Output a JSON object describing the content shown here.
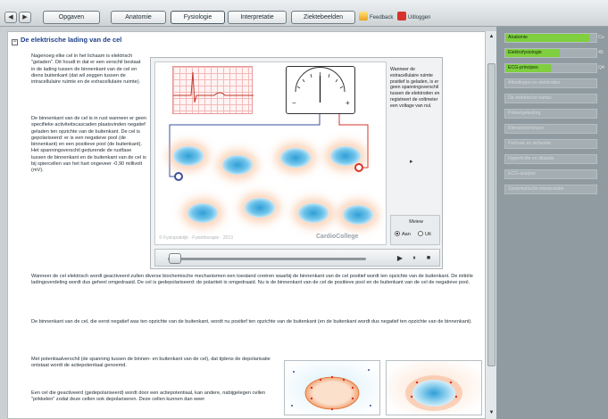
{
  "toolbar": {
    "back": "◀",
    "forward": "▶",
    "tabs": [
      "Opgaven",
      "Anatomie",
      "Fysiologie",
      "Interpretatie",
      "Ziektebeelden"
    ],
    "feedback": "Feedback",
    "exit": "Uitloggen"
  },
  "main": {
    "title": "De elektrische lading van de cel",
    "collapse": "−",
    "intro": "Nagenoeg elke cel in het lichaam is elektrisch \"geladen\". Dit houdt in dat er een verschil bestaat in de lading tussen de binnenkant van de cel en diens buitenkant (dat wil zeggen tussen de intracellulaire ruimte en de extracellulaire ruimte).",
    "rest": "De binnenkant van de cel is in rust wanneer er geen specifieke activiteitscascaden plaatsvinden negatief geladen ten opzichte van de buitenkant. De cel is gepolariseerd: er is een negatieve pool (de binnenkant) en een positieve pool (de buitenkant). Het spanningsverschil gedurende de rustfase tussen de binnenkant en de buitenkant van de cel is bij spiercellen van het hart ongeveer -0,90 millivolt (mV).",
    "depol1": "Wanneer de cel elektrisch wordt geactiveerd zullen diverse biochemische mechanismen een toestand creëren waarbij de binnenkant van de cel positief wordt ten opzichte van de buitenkant. De initiële ladingsverdeling wordt dus geheel omgedraaid. De cel is gedepolariseerd: de polariteit is omgedraaid. Nu is de binnenkant van de cel de positieve pool en de buitenkant van de cel de negatieve pool.",
    "depol2": "De binnenkant van de cel, die eerst negatief was ten opzichte van de buitenkant, wordt nu positief ten opzichte van de buitenkant (en de buitenkant wordt dus negatief ten opzichte van de binnenkant).",
    "ap1": "Met potentiaalverschil (de spanning tussen de binnen- en buitenkant van de cel), dat tijdens de depolarisatie ontstaat wordt de actiepotentiaal genoemd.",
    "ap2": "Een cel die geactiveerd (gedepolariseerd) wordt door een actiepotentiaal, kan andere, nabijgelegen cellen \"prikkelen\" zodat deze cellen ook depolariseren. Deze cellen kunnen dan weer"
  },
  "animation": {
    "side_text": "Wanneer de extracellulaire ruimte positief is geladen, is er geen spanningsverschil tussen de elektroden en registreert de voltmeter een voltage van nul.",
    "meter_minus": "−",
    "meter_plus": "+",
    "watermark": "© Fysiopraktijk · Fysiotherapie · 2013",
    "brand": "CardioCollege",
    "next": "▸",
    "mview": "Mview",
    "radio_on": "Aan",
    "radio_off": "Uit",
    "play": "▶",
    "pause": "⏸",
    "stop": "■",
    "progress_fraction": 0.03
  },
  "right": {
    "items": [
      {
        "label": "Anatomie",
        "cut": "Cu",
        "progress": 0.92
      },
      {
        "label": "Elektrofysiologie",
        "cut": "45",
        "progress": 0.6
      },
      {
        "label": "ECG-principes",
        "cut": "Q4",
        "progress": 0.5
      },
      {
        "label": "Afleidingen en elektroden",
        "cut": "",
        "progress": 0
      },
      {
        "label": "De elektrische hartas",
        "cut": "",
        "progress": 0
      },
      {
        "label": "Prikkelgeleiding",
        "cut": "",
        "progress": 0
      },
      {
        "label": "Ritmestoornissen",
        "cut": "",
        "progress": 0
      },
      {
        "label": "Perfusie en ischemie",
        "cut": "",
        "progress": 0
      },
      {
        "label": "Hypertrofie en dilatatie",
        "cut": "",
        "progress": 0
      },
      {
        "label": "ECG-analyse",
        "cut": "",
        "progress": 0
      },
      {
        "label": "Systematische interpretatie",
        "cut": "",
        "progress": 0
      }
    ]
  },
  "colors": {
    "accent_green": "#7fcf3e",
    "title_blue": "#1d3f8a",
    "electrode_negative": "#3a4f9c",
    "electrode_positive": "#d6342b"
  }
}
